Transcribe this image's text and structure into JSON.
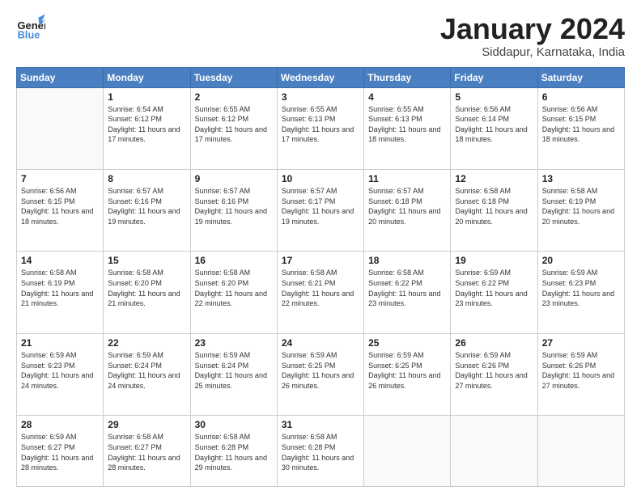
{
  "header": {
    "logo_general": "General",
    "logo_blue": "Blue",
    "month": "January 2024",
    "location": "Siddapur, Karnataka, India"
  },
  "weekdays": [
    "Sunday",
    "Monday",
    "Tuesday",
    "Wednesday",
    "Thursday",
    "Friday",
    "Saturday"
  ],
  "weeks": [
    [
      {
        "day": "",
        "empty": true
      },
      {
        "day": "1",
        "sunrise": "Sunrise: 6:54 AM",
        "sunset": "Sunset: 6:12 PM",
        "daylight": "Daylight: 11 hours and 17 minutes."
      },
      {
        "day": "2",
        "sunrise": "Sunrise: 6:55 AM",
        "sunset": "Sunset: 6:12 PM",
        "daylight": "Daylight: 11 hours and 17 minutes."
      },
      {
        "day": "3",
        "sunrise": "Sunrise: 6:55 AM",
        "sunset": "Sunset: 6:13 PM",
        "daylight": "Daylight: 11 hours and 17 minutes."
      },
      {
        "day": "4",
        "sunrise": "Sunrise: 6:55 AM",
        "sunset": "Sunset: 6:13 PM",
        "daylight": "Daylight: 11 hours and 18 minutes."
      },
      {
        "day": "5",
        "sunrise": "Sunrise: 6:56 AM",
        "sunset": "Sunset: 6:14 PM",
        "daylight": "Daylight: 11 hours and 18 minutes."
      },
      {
        "day": "6",
        "sunrise": "Sunrise: 6:56 AM",
        "sunset": "Sunset: 6:15 PM",
        "daylight": "Daylight: 11 hours and 18 minutes."
      }
    ],
    [
      {
        "day": "7",
        "sunrise": "Sunrise: 6:56 AM",
        "sunset": "Sunset: 6:15 PM",
        "daylight": "Daylight: 11 hours and 18 minutes."
      },
      {
        "day": "8",
        "sunrise": "Sunrise: 6:57 AM",
        "sunset": "Sunset: 6:16 PM",
        "daylight": "Daylight: 11 hours and 19 minutes."
      },
      {
        "day": "9",
        "sunrise": "Sunrise: 6:57 AM",
        "sunset": "Sunset: 6:16 PM",
        "daylight": "Daylight: 11 hours and 19 minutes."
      },
      {
        "day": "10",
        "sunrise": "Sunrise: 6:57 AM",
        "sunset": "Sunset: 6:17 PM",
        "daylight": "Daylight: 11 hours and 19 minutes."
      },
      {
        "day": "11",
        "sunrise": "Sunrise: 6:57 AM",
        "sunset": "Sunset: 6:18 PM",
        "daylight": "Daylight: 11 hours and 20 minutes."
      },
      {
        "day": "12",
        "sunrise": "Sunrise: 6:58 AM",
        "sunset": "Sunset: 6:18 PM",
        "daylight": "Daylight: 11 hours and 20 minutes."
      },
      {
        "day": "13",
        "sunrise": "Sunrise: 6:58 AM",
        "sunset": "Sunset: 6:19 PM",
        "daylight": "Daylight: 11 hours and 20 minutes."
      }
    ],
    [
      {
        "day": "14",
        "sunrise": "Sunrise: 6:58 AM",
        "sunset": "Sunset: 6:19 PM",
        "daylight": "Daylight: 11 hours and 21 minutes."
      },
      {
        "day": "15",
        "sunrise": "Sunrise: 6:58 AM",
        "sunset": "Sunset: 6:20 PM",
        "daylight": "Daylight: 11 hours and 21 minutes."
      },
      {
        "day": "16",
        "sunrise": "Sunrise: 6:58 AM",
        "sunset": "Sunset: 6:20 PM",
        "daylight": "Daylight: 11 hours and 22 minutes."
      },
      {
        "day": "17",
        "sunrise": "Sunrise: 6:58 AM",
        "sunset": "Sunset: 6:21 PM",
        "daylight": "Daylight: 11 hours and 22 minutes."
      },
      {
        "day": "18",
        "sunrise": "Sunrise: 6:58 AM",
        "sunset": "Sunset: 6:22 PM",
        "daylight": "Daylight: 11 hours and 23 minutes."
      },
      {
        "day": "19",
        "sunrise": "Sunrise: 6:59 AM",
        "sunset": "Sunset: 6:22 PM",
        "daylight": "Daylight: 11 hours and 23 minutes."
      },
      {
        "day": "20",
        "sunrise": "Sunrise: 6:59 AM",
        "sunset": "Sunset: 6:23 PM",
        "daylight": "Daylight: 11 hours and 23 minutes."
      }
    ],
    [
      {
        "day": "21",
        "sunrise": "Sunrise: 6:59 AM",
        "sunset": "Sunset: 6:23 PM",
        "daylight": "Daylight: 11 hours and 24 minutes."
      },
      {
        "day": "22",
        "sunrise": "Sunrise: 6:59 AM",
        "sunset": "Sunset: 6:24 PM",
        "daylight": "Daylight: 11 hours and 24 minutes."
      },
      {
        "day": "23",
        "sunrise": "Sunrise: 6:59 AM",
        "sunset": "Sunset: 6:24 PM",
        "daylight": "Daylight: 11 hours and 25 minutes."
      },
      {
        "day": "24",
        "sunrise": "Sunrise: 6:59 AM",
        "sunset": "Sunset: 6:25 PM",
        "daylight": "Daylight: 11 hours and 26 minutes."
      },
      {
        "day": "25",
        "sunrise": "Sunrise: 6:59 AM",
        "sunset": "Sunset: 6:25 PM",
        "daylight": "Daylight: 11 hours and 26 minutes."
      },
      {
        "day": "26",
        "sunrise": "Sunrise: 6:59 AM",
        "sunset": "Sunset: 6:26 PM",
        "daylight": "Daylight: 11 hours and 27 minutes."
      },
      {
        "day": "27",
        "sunrise": "Sunrise: 6:59 AM",
        "sunset": "Sunset: 6:26 PM",
        "daylight": "Daylight: 11 hours and 27 minutes."
      }
    ],
    [
      {
        "day": "28",
        "sunrise": "Sunrise: 6:59 AM",
        "sunset": "Sunset: 6:27 PM",
        "daylight": "Daylight: 11 hours and 28 minutes."
      },
      {
        "day": "29",
        "sunrise": "Sunrise: 6:58 AM",
        "sunset": "Sunset: 6:27 PM",
        "daylight": "Daylight: 11 hours and 28 minutes."
      },
      {
        "day": "30",
        "sunrise": "Sunrise: 6:58 AM",
        "sunset": "Sunset: 6:28 PM",
        "daylight": "Daylight: 11 hours and 29 minutes."
      },
      {
        "day": "31",
        "sunrise": "Sunrise: 6:58 AM",
        "sunset": "Sunset: 6:28 PM",
        "daylight": "Daylight: 11 hours and 30 minutes."
      },
      {
        "day": "",
        "empty": true
      },
      {
        "day": "",
        "empty": true
      },
      {
        "day": "",
        "empty": true
      }
    ]
  ]
}
